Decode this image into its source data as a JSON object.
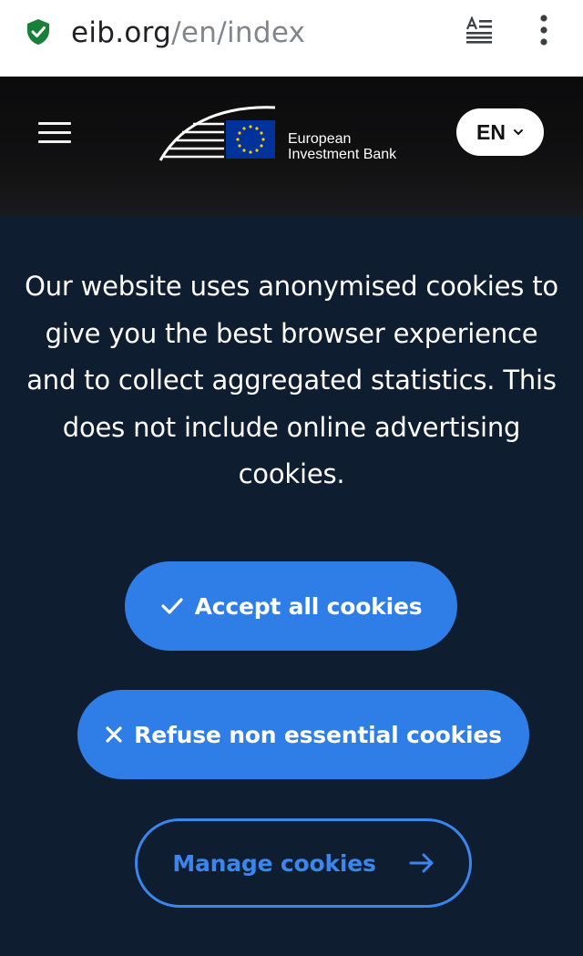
{
  "browser": {
    "url_host": "eib.org",
    "url_path": "/en/index",
    "icons": [
      "shield-check-icon",
      "reader-mode-icon",
      "more-vertical-icon"
    ],
    "colors": {
      "shield": "#188038",
      "text": "#202124",
      "path": "#80868b"
    }
  },
  "header": {
    "logo_line1": "European",
    "logo_line2": "Investment Bank",
    "language": "EN",
    "icons": [
      "hamburger-menu-icon",
      "eu-flag-icon",
      "chevron-down-icon"
    ]
  },
  "cookie_banner": {
    "message": "Our website uses anonymised cookies to give you the best browser experience and to collect aggregated statistics. This does not include online advertising cookies.",
    "accept_label": "Accept all cookies",
    "refuse_label": "Refuse non essential cookies",
    "manage_label": "Manage cookies",
    "colors": {
      "background": "#0f1d31",
      "button": "#2f7de6",
      "outline": "#3a86ec"
    }
  }
}
